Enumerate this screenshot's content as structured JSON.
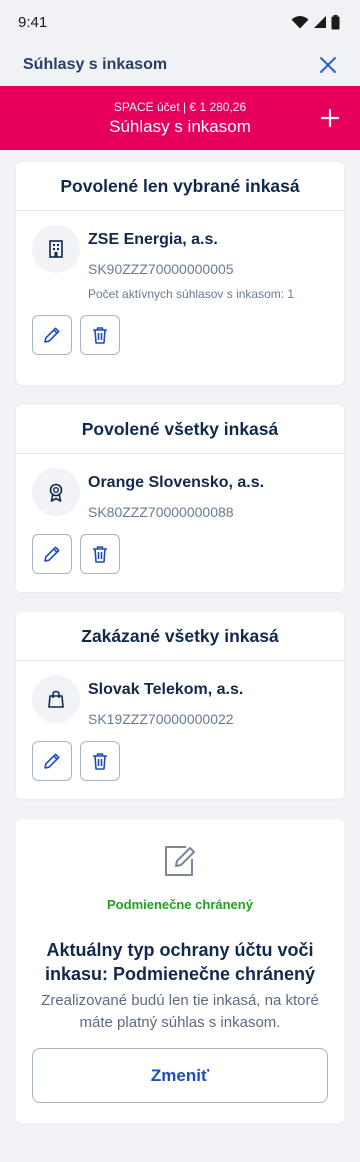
{
  "status_bar": {
    "time": "9:41"
  },
  "header": {
    "title": "Súhlasy s inkasom"
  },
  "banner": {
    "account_line": "SPACE účet | € 1 280,26",
    "title": "Súhlasy s inkasom",
    "accent_color": "#e6005c"
  },
  "cards": [
    {
      "heading": "Povolené len vybrané inkasá",
      "entry": {
        "icon": "building-icon",
        "name": "ZSE Energia, a.s.",
        "iban": "SK90ZZZ70000000005",
        "count": "Počet aktívnych súhlasov s inkasom: 1"
      }
    },
    {
      "heading": "Povolené všetky  inkasá",
      "entry": {
        "icon": "award-icon",
        "name": "Orange Slovensko, a.s.",
        "iban": "SK80ZZZ70000000088"
      }
    },
    {
      "heading": "Zakázané všetky  inkasá",
      "entry": {
        "icon": "shopping-bag-icon",
        "name": "Slovak Telekom, a.s.",
        "iban": "SK19ZZZ70000000022"
      }
    }
  ],
  "protection": {
    "icon": "edit-note-icon",
    "status": "Podmienečne chránený",
    "status_color": "#1ea21e",
    "title": "Aktuálny typ ochrany účtu voči inkasu: Podmienečne chránený",
    "description": "Zrealizované budú len tie inkasá, na ktoré máte platný súhlas s inkasom.",
    "button_label": "Zmeniť"
  }
}
